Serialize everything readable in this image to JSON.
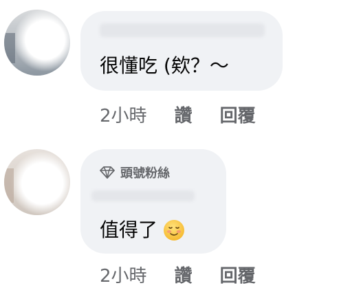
{
  "comments": [
    {
      "text": "很懂吃 (欸？～",
      "time": "2小時",
      "like_label": "讚",
      "reply_label": "回覆"
    },
    {
      "badge": "頭號粉絲",
      "text": "值得了",
      "emoji": "smiling-face-icon",
      "time": "2小時",
      "like_label": "讚",
      "reply_label": "回覆"
    }
  ],
  "colors": {
    "bubble_bg": "#f0f2f5",
    "meta_text": "#65676b",
    "text": "#050505"
  }
}
